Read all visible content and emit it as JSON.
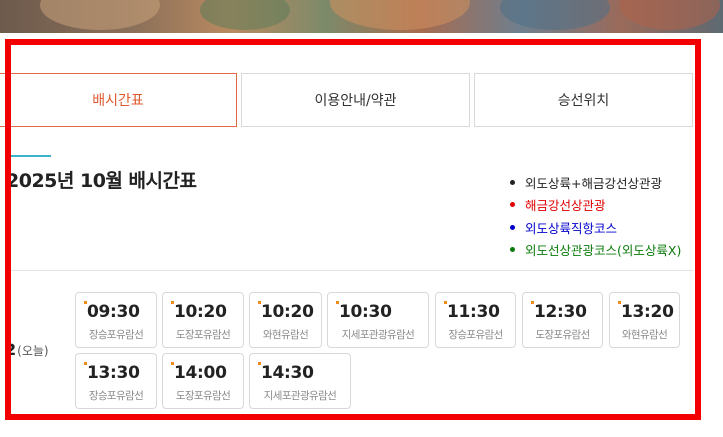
{
  "tabs": [
    {
      "label": "배시간표",
      "active": true
    },
    {
      "label": "이용안내/약관",
      "active": false
    },
    {
      "label": "승선위치",
      "active": false
    }
  ],
  "schedule": {
    "title": "2025년 10월 배시간표",
    "legend": [
      {
        "label": "외도상륙+해금강선상관광",
        "color": "#222222"
      },
      {
        "label": "해금강선상관광",
        "color": "#e00000"
      },
      {
        "label": "외도상륙직항코스",
        "color": "#0000cc"
      },
      {
        "label": "외도선상관광코스(외도상륙X)",
        "color": "#0a7a0a"
      }
    ],
    "day": {
      "num": "2",
      "sub": "(오늘)"
    },
    "slots": [
      {
        "time": "09:30",
        "route": "장승포유람선"
      },
      {
        "time": "10:20",
        "route": "도장포유람선"
      },
      {
        "time": "10:20",
        "route": "와현유람선"
      },
      {
        "time": "10:30",
        "route": "지세포관광유람선"
      },
      {
        "time": "11:30",
        "route": "장승포유람선"
      },
      {
        "time": "12:30",
        "route": "도장포유람선"
      },
      {
        "time": "13:20",
        "route": "와현유람선"
      },
      {
        "time": "13:30",
        "route": "장승포유람선"
      },
      {
        "time": "14:00",
        "route": "도장포유람선"
      },
      {
        "time": "14:30",
        "route": "지세포관광유람선"
      }
    ]
  },
  "colors": {
    "highlight": "#f20000",
    "active_tab": "#e05a2f",
    "slot_mark": "#f08a1e",
    "title_accent": "#3bb3c7"
  }
}
